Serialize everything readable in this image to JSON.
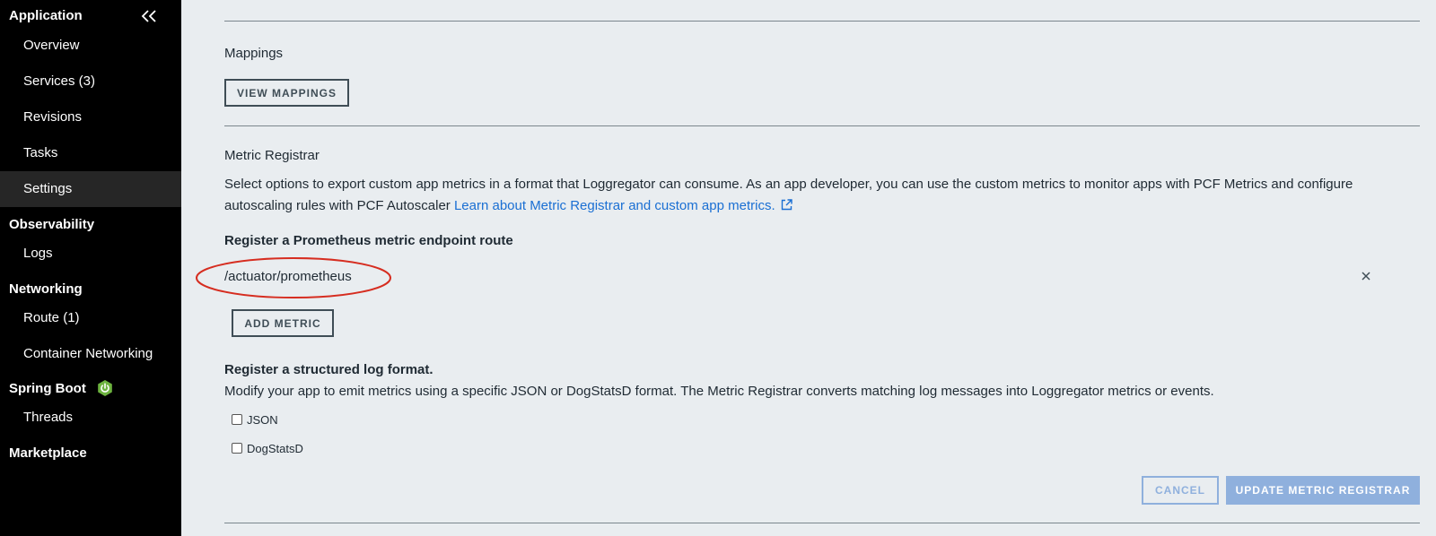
{
  "sidebar": {
    "sections": [
      {
        "label": "Application"
      },
      {
        "label": "Observability"
      },
      {
        "label": "Networking"
      },
      {
        "label": "Spring Boot"
      },
      {
        "label": "Marketplace"
      }
    ],
    "items": [
      {
        "label": "Overview"
      },
      {
        "label": "Services (3)"
      },
      {
        "label": "Revisions"
      },
      {
        "label": "Tasks"
      },
      {
        "label": "Settings",
        "active": true
      },
      {
        "label": "Logs"
      },
      {
        "label": "Route (1)"
      },
      {
        "label": "Container Networking"
      },
      {
        "label": "Threads"
      }
    ],
    "collapse_icon": "double-chevron-left-icon",
    "spring_boot_icon": "power-icon",
    "spring_boot_icon_color": "#6db33f"
  },
  "mappings": {
    "title": "Mappings",
    "button_label": "VIEW MAPPINGS"
  },
  "metric_registrar": {
    "title": "Metric Registrar",
    "description": "Select options to export custom app metrics in a format that Loggregator can consume. As an app developer, you can use the custom metrics to monitor apps with PCF Metrics and configure autoscaling rules with PCF Autoscaler ",
    "link_text": "Learn about Metric Registrar and custom app metrics.",
    "link_icon": "external-link-icon",
    "endpoint_label": "Register a Prometheus metric endpoint route",
    "endpoint_value": "/actuator/prometheus",
    "remove_icon": "close-icon",
    "add_metric_label": "ADD METRIC",
    "structured_log_label": "Register a structured log format.",
    "structured_log_description": "Modify your app to emit metrics using a specific JSON or DogStatsD format. The Metric Registrar converts matching log messages into Loggregator metrics or events.",
    "formats": [
      {
        "label": "JSON",
        "checked": false
      },
      {
        "label": "DogStatsD",
        "checked": false
      }
    ],
    "cancel_label": "CANCEL",
    "update_label": "UPDATE METRIC REGISTRAR"
  },
  "colors": {
    "sidebar_bg": "#000000",
    "main_bg": "#e9edf0",
    "link": "#1a6fd3",
    "annotation_ellipse": "#d62d20",
    "disabled_button": "#8fb0dd"
  }
}
